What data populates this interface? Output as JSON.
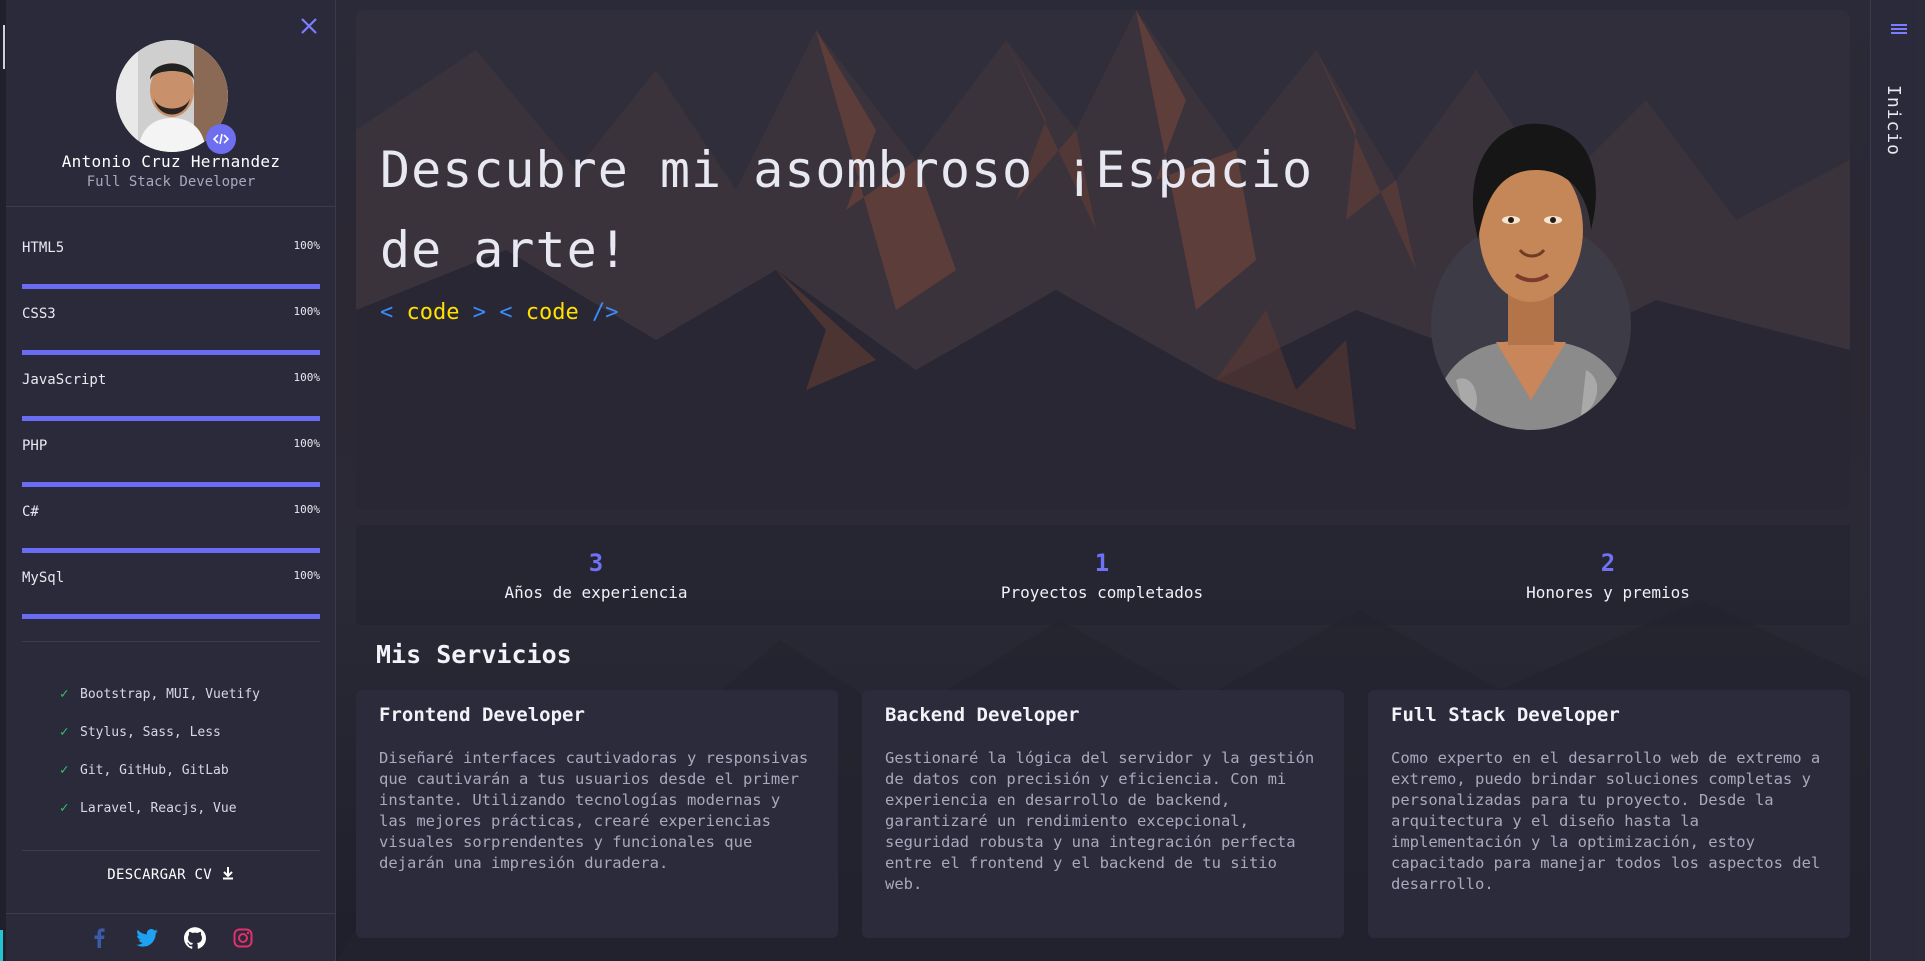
{
  "sidebar": {
    "profile": {
      "name": "Antonio Cruz Hernandez",
      "role": "Full Stack Developer"
    },
    "skills": [
      {
        "name": "HTML5",
        "percent": "100%",
        "level": 1.0
      },
      {
        "name": "CSS3",
        "percent": "100%",
        "level": 1.0
      },
      {
        "name": "JavaScript",
        "percent": "100%",
        "level": 1.0
      },
      {
        "name": "PHP",
        "percent": "100%",
        "level": 1.0
      },
      {
        "name": "C#",
        "percent": "100%",
        "level": 1.0
      },
      {
        "name": "MySql",
        "percent": "100%",
        "level": 1.0
      }
    ],
    "extras": [
      "Bootstrap, MUI, Vuetify",
      "Stylus, Sass, Less",
      "Git, GitHub, GitLab",
      "Laravel, Reacjs, Vue"
    ],
    "cv_label": "DESCARGAR CV",
    "socials": [
      "facebook-icon",
      "twitter-icon",
      "github-icon",
      "instagram-icon"
    ]
  },
  "right_strip": {
    "label": "Inicio"
  },
  "hero": {
    "title": "Descubre mi asombroso ¡Espacio de arte!",
    "code_open1": "< ",
    "code_word1": "code",
    "code_close1": " >",
    "code_open2": " < ",
    "code_word2": "code",
    "code_close2": " />"
  },
  "stats": [
    {
      "value": "3",
      "label": "Años de experiencia"
    },
    {
      "value": "1",
      "label": "Proyectos completados"
    },
    {
      "value": "2",
      "label": "Honores y premios"
    }
  ],
  "services": {
    "title": "Mis Servicios",
    "cards": [
      {
        "title": "Frontend Developer",
        "text": "Diseñaré interfaces cautivadoras y responsivas que cautivarán a tus usuarios desde el primer instante. Utilizando tecnologías modernas y las mejores prácticas, crearé experiencias visuales sorprendentes y funcionales que dejarán una impresión duradera."
      },
      {
        "title": "Backend Developer",
        "text": "Gestionaré la lógica del servidor y la gestión de datos con precisión y eficiencia. Con mi experiencia en desarrollo de backend, garantizaré un rendimiento excepcional, seguridad robusta y una integración perfecta entre el frontend y el backend de tu sitio web."
      },
      {
        "title": "Full Stack Developer",
        "text": "Como experto en el desarrollo web de extremo a extremo, puedo brindar soluciones completas y personalizadas para tu proyecto. Desde la arquitectura y el diseño hasta la implementación y la optimización, estoy capacitado para manejar todos los aspectos del desarrollo."
      }
    ]
  },
  "colors": {
    "accent": "#6d6ef0",
    "sidebar_bg": "#2a2a3a",
    "code_yellow": "#ffe000",
    "code_blue": "#3b8cff",
    "check_green": "#33c46b"
  }
}
